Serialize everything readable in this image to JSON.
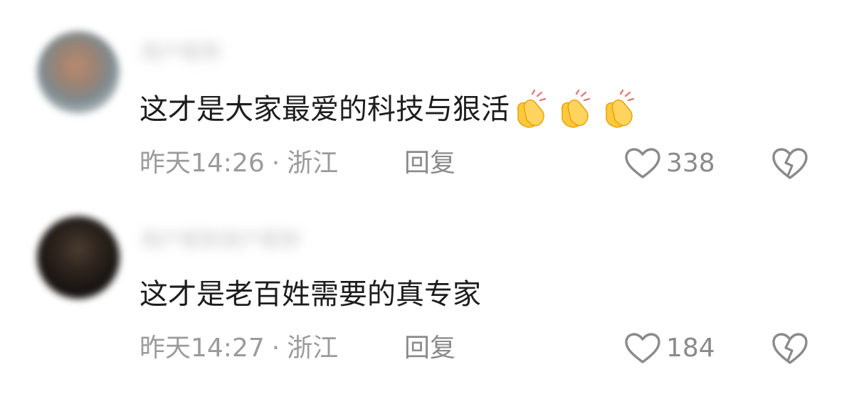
{
  "comments": [
    {
      "username": "用户昵称",
      "text": "这才是大家最爱的科技与狠活",
      "emojis": [
        "clapping-hands",
        "clapping-hands",
        "clapping-hands"
      ],
      "time": "昨天14:26",
      "separator": "·",
      "location": "浙江",
      "reply_label": "回复",
      "likes": "338"
    },
    {
      "username": "用户昵称用户昵称",
      "text": "这才是老百姓需要的真专家",
      "emojis": [],
      "time": "昨天14:27",
      "separator": "·",
      "location": "浙江",
      "reply_label": "回复",
      "likes": "184"
    }
  ],
  "colors": {
    "text": "#1d1d1d",
    "meta": "#9b9b9b",
    "icon": "#8a8a8a",
    "emoji": "#ffc83d"
  }
}
